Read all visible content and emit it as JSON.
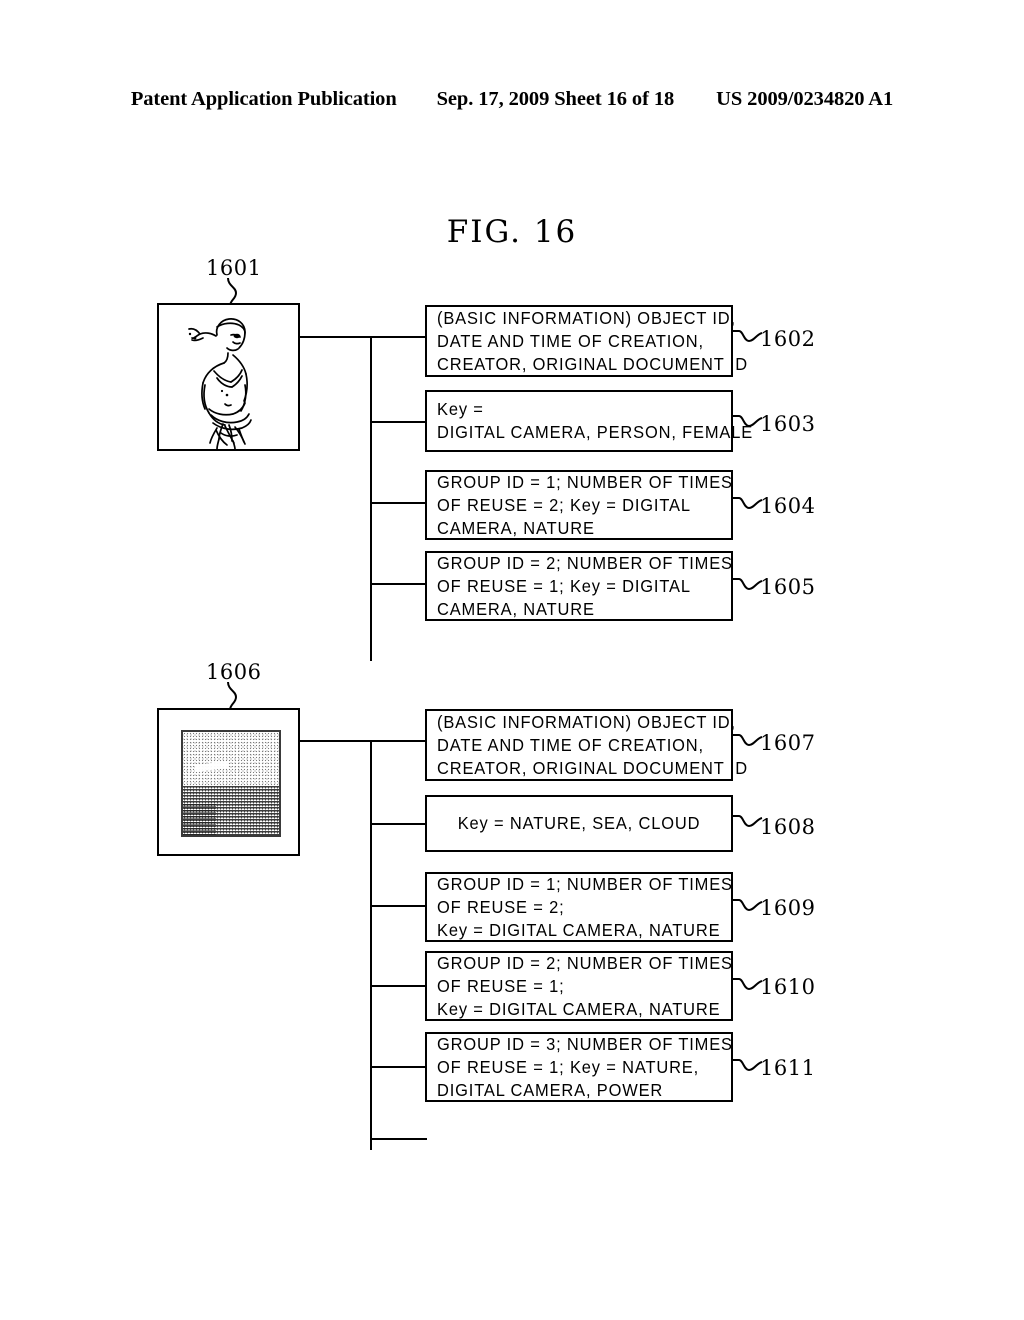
{
  "header": {
    "publication": "Patent Application Publication",
    "date_sheet": "Sep. 17, 2009   Sheet 16 of 18",
    "patent_number": "US 2009/0234820 A1"
  },
  "figure": {
    "title": "FIG. 16"
  },
  "objects": [
    {
      "id": "1601",
      "label": "1601",
      "thumbnail_kind": "person-line-art",
      "records": [
        {
          "ref": "1602",
          "align": "left",
          "lines": [
            "(BASIC INFORMATION) OBJECT ID,",
            "DATE AND TIME OF CREATION,",
            "CREATOR, ORIGINAL DOCUMENT ID"
          ]
        },
        {
          "ref": "1603",
          "align": "left",
          "lines": [
            "Key =",
            "DIGITAL CAMERA, PERSON, FEMALE"
          ]
        },
        {
          "ref": "1604",
          "align": "left",
          "lines": [
            "GROUP ID = 1; NUMBER OF TIMES",
            "OF REUSE = 2; Key = DIGITAL",
            "CAMERA, NATURE"
          ]
        },
        {
          "ref": "1605",
          "align": "left",
          "lines": [
            "GROUP ID = 2; NUMBER OF TIMES",
            "OF REUSE = 1; Key = DIGITAL",
            "CAMERA, NATURE"
          ]
        }
      ]
    },
    {
      "id": "1606",
      "label": "1606",
      "thumbnail_kind": "sea-cloud-halftone",
      "records": [
        {
          "ref": "1607",
          "align": "left",
          "lines": [
            "(BASIC INFORMATION) OBJECT ID,",
            "DATE AND TIME OF CREATION,",
            "CREATOR, ORIGINAL DOCUMENT ID"
          ]
        },
        {
          "ref": "1608",
          "align": "center",
          "lines": [
            "Key = NATURE, SEA, CLOUD"
          ]
        },
        {
          "ref": "1609",
          "align": "left",
          "lines": [
            "GROUP ID = 1; NUMBER OF TIMES",
            "OF REUSE = 2;",
            "Key = DIGITAL CAMERA, NATURE"
          ]
        },
        {
          "ref": "1610",
          "align": "left",
          "lines": [
            "GROUP ID = 2; NUMBER OF TIMES",
            "OF REUSE = 1;",
            "Key = DIGITAL CAMERA, NATURE"
          ]
        },
        {
          "ref": "1611",
          "align": "left",
          "lines": [
            "GROUP ID = 3; NUMBER OF TIMES",
            "OF REUSE = 1; Key = NATURE,",
            "DIGITAL CAMERA, POWER"
          ]
        }
      ]
    }
  ]
}
